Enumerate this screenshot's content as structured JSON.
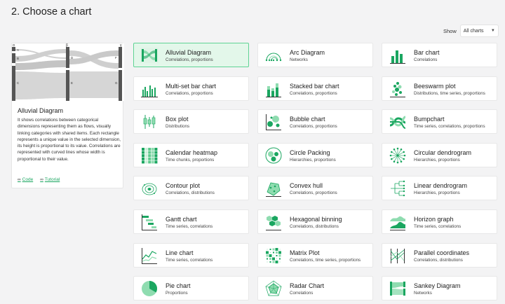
{
  "page": {
    "title": "2. Choose a chart"
  },
  "filter": {
    "label": "Show",
    "value": "All charts"
  },
  "preview": {
    "axis_labels": [
      "α",
      "β",
      "γ"
    ],
    "node_labels": [
      "A",
      "B",
      "C",
      "D",
      "E",
      "F",
      "G"
    ],
    "title": "Alluvial Diagram",
    "description": "It shows correlations between categorical dimensions representing them as flows, visually linking categories with shared items. Each rectangle represents a unique value in the selected dimension, its height is proportional to its value. Correlations are represented with curved lines whose width is proportional to their value.",
    "links": [
      {
        "label": "Code",
        "icon": "link-icon"
      },
      {
        "label": "Tutorial",
        "icon": "link-icon"
      }
    ]
  },
  "accent_color": "#1aa660",
  "selected_color": "#e3f7ea",
  "charts": [
    {
      "name": "Alluvial Diagram",
      "tags": "Correlations, proportions",
      "icon": "alluvial-icon",
      "selected": true
    },
    {
      "name": "Arc Diagram",
      "tags": "Networks",
      "icon": "arc-icon"
    },
    {
      "name": "Bar chart",
      "tags": "Correlations",
      "icon": "bar-icon"
    },
    {
      "name": "Multi-set bar chart",
      "tags": "Correlations, proportions",
      "icon": "multiset-bar-icon"
    },
    {
      "name": "Stacked bar chart",
      "tags": "Correlations, proportions",
      "icon": "stacked-bar-icon"
    },
    {
      "name": "Beeswarm plot",
      "tags": "Distributions, time series, proportions",
      "icon": "beeswarm-icon"
    },
    {
      "name": "Box plot",
      "tags": "Distributions",
      "icon": "boxplot-icon"
    },
    {
      "name": "Bubble chart",
      "tags": "Correlations, proportions",
      "icon": "bubble-icon"
    },
    {
      "name": "Bumpchart",
      "tags": "Time series, correlations, proportions",
      "icon": "bump-icon"
    },
    {
      "name": "Calendar heatmap",
      "tags": "Time chunks, proportions",
      "icon": "calendar-icon"
    },
    {
      "name": "Circle Packing",
      "tags": "Hierarchies, proportions",
      "icon": "circle-packing-icon"
    },
    {
      "name": "Circular dendrogram",
      "tags": "Hierarchies, proportions",
      "icon": "circular-dendrogram-icon"
    },
    {
      "name": "Contour plot",
      "tags": "Correlations, distributions",
      "icon": "contour-icon"
    },
    {
      "name": "Convex hull",
      "tags": "Correlations, proportions",
      "icon": "convex-hull-icon"
    },
    {
      "name": "Linear dendrogram",
      "tags": "Hierarchies, proportions",
      "icon": "linear-dendrogram-icon"
    },
    {
      "name": "Gantt chart",
      "tags": "Time series, correlations",
      "icon": "gantt-icon"
    },
    {
      "name": "Hexagonal binning",
      "tags": "Correlations, distributions",
      "icon": "hexbin-icon"
    },
    {
      "name": "Horizon graph",
      "tags": "Time series, correlations",
      "icon": "horizon-icon"
    },
    {
      "name": "Line chart",
      "tags": "Time series, correlations",
      "icon": "line-icon"
    },
    {
      "name": "Matrix Plot",
      "tags": "Correlations, time series, proportions",
      "icon": "matrix-icon"
    },
    {
      "name": "Parallel coordinates",
      "tags": "Correlations, distributions",
      "icon": "parallel-icon"
    },
    {
      "name": "Pie chart",
      "tags": "Proportions",
      "icon": "pie-icon"
    },
    {
      "name": "Radar Chart",
      "tags": "Correlations",
      "icon": "radar-icon"
    },
    {
      "name": "Sankey Diagram",
      "tags": "Networks",
      "icon": "sankey-icon"
    }
  ]
}
